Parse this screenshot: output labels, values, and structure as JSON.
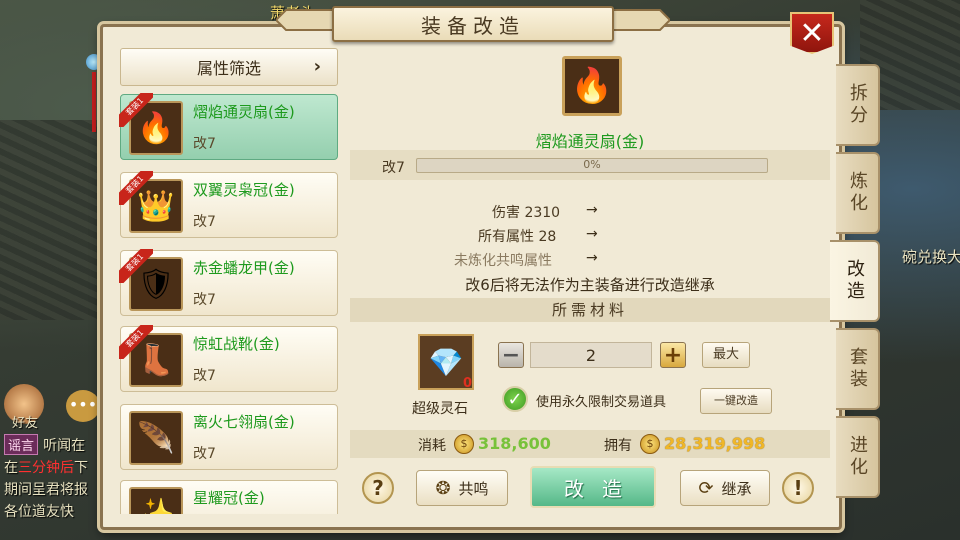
{
  "scene": {
    "top_name": "萧老头",
    "right_name": "碗兑换大侠",
    "friend_label": "好友",
    "chat_tag": "谣言",
    "chat_lines": [
      "听闻在",
      "在",
      "三分钟后",
      "下",
      "期间呈君将报",
      "各位道友快"
    ]
  },
  "window": {
    "title": "装备改造",
    "close_label": "✕"
  },
  "filter": {
    "label": "属性筛选",
    "arrow": "›"
  },
  "items": [
    {
      "name": "熠焰通灵扇(金)",
      "level": "改7",
      "badge": "套装1",
      "icon": "fan-fire-icon",
      "glyph": "🔥",
      "selected": true
    },
    {
      "name": "双翼灵枭冠(金)",
      "level": "改7",
      "badge": "套装1",
      "icon": "crown-wing-icon",
      "glyph": "👑",
      "selected": false
    },
    {
      "name": "赤金蟠龙甲(金)",
      "level": "改7",
      "badge": "套装1",
      "icon": "armor-icon",
      "glyph": "🛡",
      "selected": false
    },
    {
      "name": "惊虹战靴(金)",
      "level": "改7",
      "badge": "套装1",
      "icon": "boots-icon",
      "glyph": "👢",
      "selected": false
    },
    {
      "name": "离火七翎扇(金)",
      "level": "改7",
      "badge": "",
      "icon": "feather-fan-icon",
      "glyph": "🪶",
      "selected": false
    },
    {
      "name": "星耀冠(金)",
      "level": "",
      "badge": "",
      "icon": "star-crown-icon",
      "glyph": "✨",
      "selected": false
    }
  ],
  "detail": {
    "equip_name": "熠焰通灵扇(金)",
    "level_label": "改7",
    "progress_text": "0%",
    "progress": 0,
    "stats": [
      {
        "label": "伤害 2310",
        "arrow": "→",
        "dim": false
      },
      {
        "label": "所有属性 28",
        "arrow": "→",
        "dim": false
      },
      {
        "label": "未炼化共鸣属性",
        "arrow": "→",
        "dim": true
      }
    ],
    "warning": "改6后将无法作为主装备进行改造继承",
    "materials_header": "所需材料",
    "material": {
      "name": "超级灵石",
      "count": "0",
      "icon": "crystal-icon"
    },
    "quantity": "2",
    "max_label": "最大",
    "use_bound_label": "使用永久限制交易道具",
    "one_key_label": "一键改造",
    "cost_label": "消耗",
    "cost_value": "318,600",
    "own_label": "拥有",
    "own_value": "28,319,998"
  },
  "actions": {
    "help": "?",
    "resonance": "共鸣",
    "forge": "改造",
    "inherit": "继承",
    "info": "!"
  },
  "tabs": [
    {
      "label": "拆分",
      "active": false
    },
    {
      "label": "炼化",
      "active": false
    },
    {
      "label": "改造",
      "active": true
    },
    {
      "label": "套装",
      "active": false
    },
    {
      "label": "进化",
      "active": false
    }
  ],
  "colors": {
    "item_name": "#1e9a1e",
    "cost": "#78c23a",
    "own": "#f0b728",
    "close": "#c6281c"
  }
}
